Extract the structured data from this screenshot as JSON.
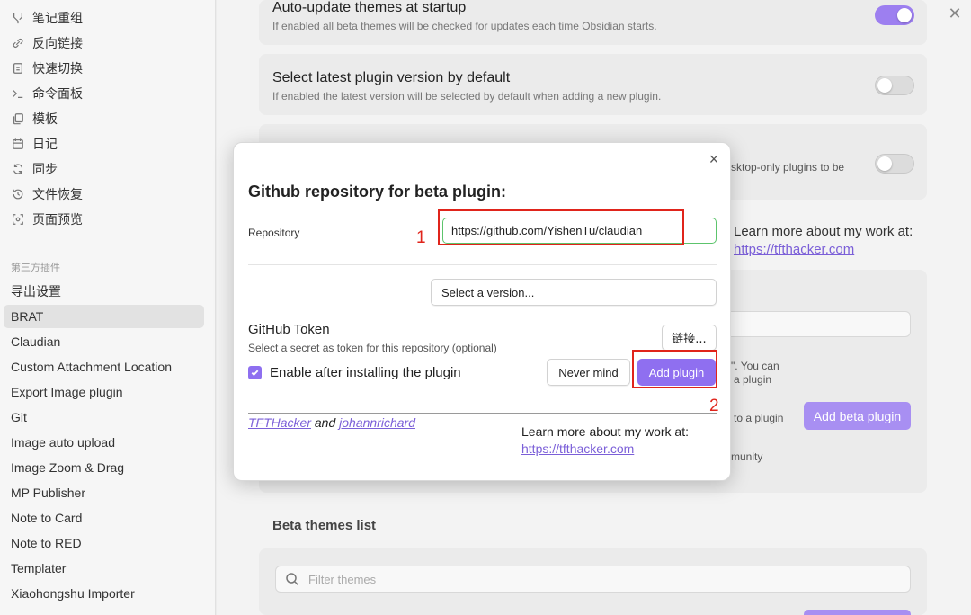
{
  "sidebar": {
    "core": [
      {
        "label": "笔记重组",
        "icon": "merge-icon"
      },
      {
        "label": "反向链接",
        "icon": "backlink-icon"
      },
      {
        "label": "快速切换",
        "icon": "quick-switch-icon"
      },
      {
        "label": "命令面板",
        "icon": "terminal-icon"
      },
      {
        "label": "模板",
        "icon": "template-icon"
      },
      {
        "label": "日记",
        "icon": "calendar-icon"
      },
      {
        "label": "同步",
        "icon": "sync-icon"
      },
      {
        "label": "文件恢复",
        "icon": "history-icon"
      },
      {
        "label": "页面预览",
        "icon": "preview-icon"
      }
    ],
    "section_label": "第三方插件",
    "plugins": [
      "导出设置",
      "BRAT",
      "Claudian",
      "Custom Attachment Location",
      "Export Image plugin",
      "Git",
      "Image auto upload",
      "Image Zoom & Drag",
      "MP Publisher",
      "Note to Card",
      "Note to RED",
      "Templater",
      "Xiaohongshu Importer"
    ],
    "active_plugin": "BRAT"
  },
  "settings": {
    "auto_update_title": "Auto-update themes at startup",
    "auto_update_desc": "If enabled all beta themes will be checked for updates each time Obsidian starts.",
    "auto_update_on": true,
    "select_latest_title": "Select latest plugin version by default",
    "select_latest_desc": "If enabled the latest version will be selected by default when adding a new plugin.",
    "select_latest_on": false,
    "desktop_only_fragment": "sktop-only plugins to be",
    "learn_more": "Learn more about my work at:",
    "learn_more_link": "https://tfthacker.com",
    "note_fragment_1": "\". You can",
    "note_fragment_2": "a plugin",
    "add_to_plugin_fragment": "to a plugin",
    "add_beta_plugin": "Add beta plugin",
    "community_fragment": "munity",
    "beta_themes_heading": "Beta themes list",
    "filter_placeholder": "Filter themes"
  },
  "modal": {
    "close": "×",
    "title": "Github repository for beta plugin:",
    "repository_label": "Repository",
    "repository_value": "https://github.com/YishenTu/claudian",
    "select_version": "Select a version...",
    "token_title": "GitHub Token",
    "token_desc": "Select a secret as token for this repository (optional)",
    "link_button": "链接...",
    "enable_label": "Enable after installing the plugin",
    "enable_checked": true,
    "never_mind": "Never mind",
    "add_plugin": "Add plugin",
    "credit_a": "TFTHacker",
    "credit_and": "and",
    "credit_b": "johannrichard",
    "learn_more": "Learn more about my work at:",
    "learn_more_link": "https://tfthacker.com"
  },
  "annotations": {
    "step1": "1",
    "step2": "2"
  },
  "colors": {
    "accent": "#8f6ff0",
    "highlight": "#e0241b",
    "input_focus": "#5cc46c"
  }
}
